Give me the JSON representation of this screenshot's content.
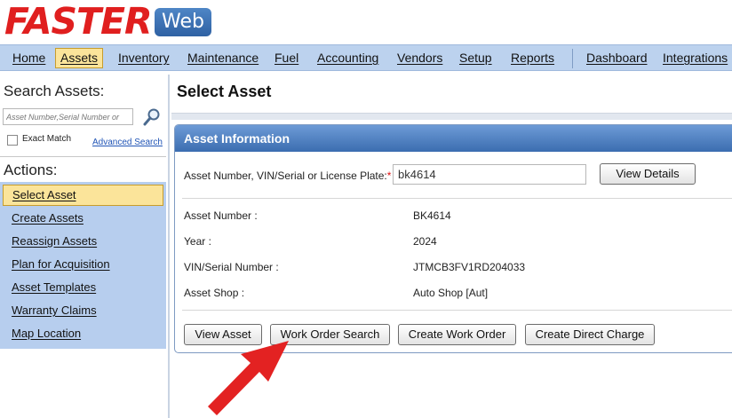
{
  "brand": {
    "name": "FASTER",
    "product": "Web"
  },
  "nav": {
    "items": [
      {
        "label": "Home"
      },
      {
        "label": "Assets"
      },
      {
        "label": "Inventory"
      },
      {
        "label": "Maintenance"
      },
      {
        "label": "Fuel"
      },
      {
        "label": "Accounting"
      },
      {
        "label": "Vendors"
      },
      {
        "label": "Setup"
      },
      {
        "label": "Reports"
      },
      {
        "label": "Dashboard"
      },
      {
        "label": "Integrations"
      }
    ],
    "active": "Assets"
  },
  "sidebar": {
    "search_title": "Search Assets:",
    "search_placeholder": "Asset Number,Serial Number or",
    "exact_match_label": "Exact Match",
    "advanced_search": "Advanced Search",
    "actions_title": "Actions:",
    "actions": [
      {
        "label": "Select Asset"
      },
      {
        "label": "Create Assets"
      },
      {
        "label": "Reassign Assets"
      },
      {
        "label": "Plan for Acquisition"
      },
      {
        "label": "Asset Templates"
      },
      {
        "label": "Warranty Claims"
      },
      {
        "label": "Map Location"
      }
    ],
    "active_action": "Select Asset"
  },
  "main": {
    "title": "Select Asset",
    "panel_title": "Asset Information",
    "lookup_label": "Asset Number, VIN/Serial or License Plate:",
    "lookup_required_mark": "*",
    "lookup_value": "bk4614",
    "view_details": "View Details",
    "fields": [
      {
        "label": "Asset Number :",
        "value": "BK4614"
      },
      {
        "label": "Year :",
        "value": "2024"
      },
      {
        "label": "VIN/Serial Number :",
        "value": "JTMCB3FV1RD204033"
      },
      {
        "label": "Asset Shop :",
        "value": "Auto Shop [Aut]"
      }
    ],
    "buttons": {
      "view_asset": "View Asset",
      "work_order_search": "Work Order Search",
      "create_work_order": "Create Work Order",
      "create_direct_charge": "Create Direct Charge"
    }
  },
  "colors": {
    "brand_red": "#e01f1f",
    "nav_bg": "#bcd2ee",
    "active_highlight": "#fbe49a",
    "panel_header": "#3b6db0",
    "callout_arrow": "#e32222"
  }
}
